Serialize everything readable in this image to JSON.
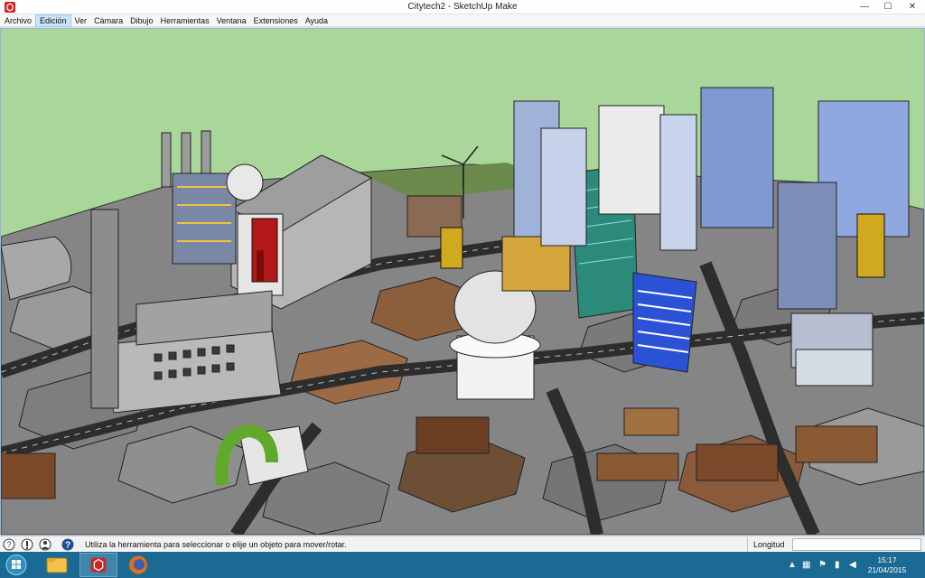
{
  "window": {
    "title": "Citytech2 - SketchUp Make",
    "minimize": "—",
    "maximize": "☐",
    "close": "✕"
  },
  "menu": {
    "items": [
      "Archivo",
      "Edición",
      "Ver",
      "Cámara",
      "Dibujo",
      "Herramientas",
      "Ventana",
      "Extensiones",
      "Ayuda"
    ],
    "active_index": 1
  },
  "scene": {
    "description_icon": "3d-city-model",
    "sky_color": "#a9d79a",
    "hex_floor_color": "#8e8e8e",
    "road_color": "#3c3c3c"
  },
  "status": {
    "hint": "Utiliza la herramienta para seleccionar o elije un objeto para mover/rotar.",
    "measure_label": "Longitud",
    "measure_value": ""
  },
  "taskbar": {
    "time": "15:17",
    "date": "21/04/2015"
  }
}
